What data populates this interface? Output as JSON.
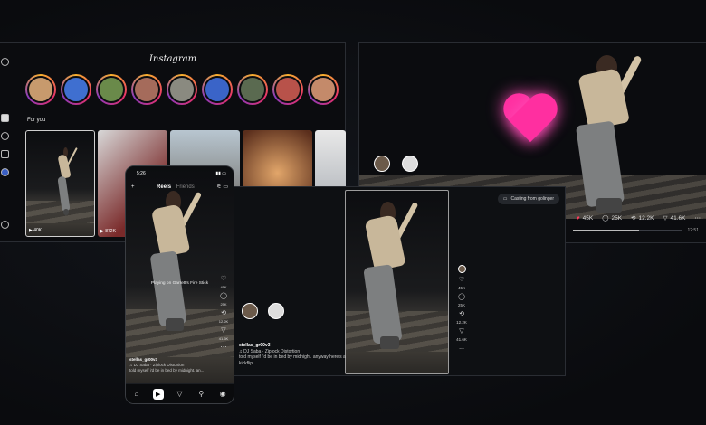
{
  "laptop": {
    "title": "Instagram",
    "section_label": "For you",
    "tile_counts": [
      "▶ 40K",
      "▶ 872K"
    ],
    "side_icons": [
      "threads-icon",
      "home-icon",
      "search-icon",
      "bookmark-icon",
      "explore-icon",
      "more-icon"
    ]
  },
  "tv": {
    "likes": "45K",
    "comments": "25K",
    "reposts": "12.2K",
    "shares": "41.6K",
    "duration": "12:51",
    "progress": 0.6
  },
  "tablet": {
    "cast_label": "Casting from golinger",
    "rail": {
      "likes": "45K",
      "comments": "25K",
      "reposts": "12.2K",
      "shares": "41.6K"
    },
    "username": "stellas_gr00v3",
    "song": "♫ DJ Saba · Ziplock Distortion",
    "caption": "told myself i'd be in bed by midnight. anyway here's a kickflip",
    "more": "..."
  },
  "phone": {
    "time": "5:26",
    "tab_reels": "Reels",
    "tab_friends": "Friends",
    "cast_text": "Playing on Garrett's Fire Stick",
    "rail": {
      "likes": "45K",
      "comments": "25K",
      "reposts": "12.2K",
      "shares": "41.6K"
    },
    "username": "stellas_gr00v3",
    "song": "♫ DJ Saba · Ziplock Distortion",
    "caption": "told myself i'd be in bed by midnight. an..."
  },
  "colors": {
    "heart": "#ff2fa0",
    "story_ring_start": "#f9b12d",
    "story_ring_mid": "#e6306a",
    "background": "#0c0e12"
  }
}
